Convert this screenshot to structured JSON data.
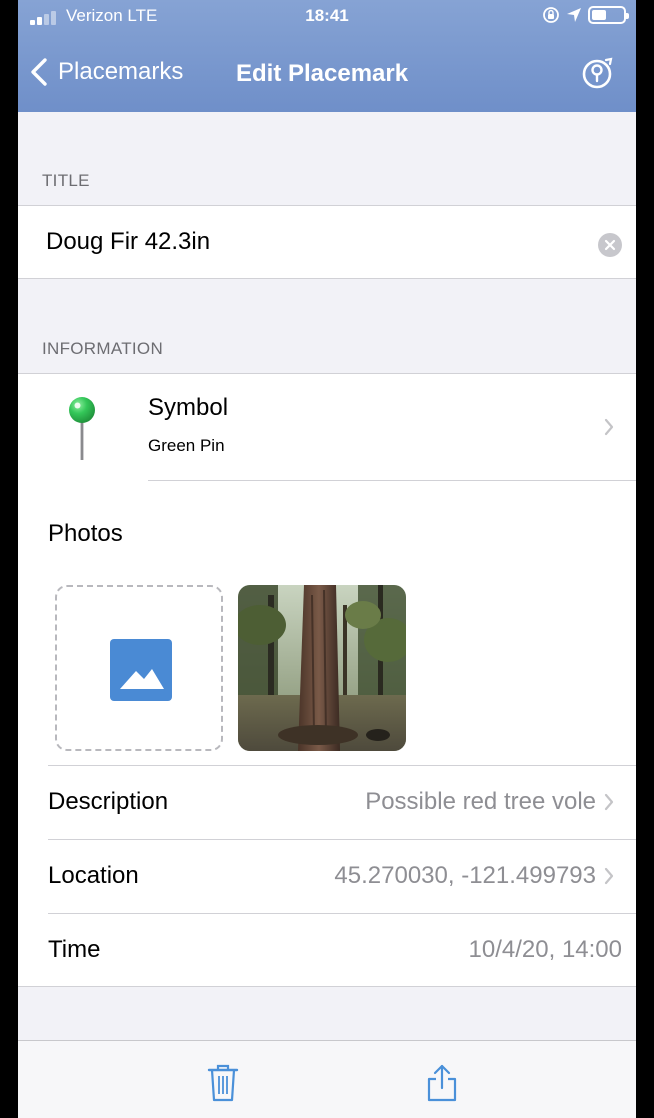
{
  "status_bar": {
    "carrier": "Verizon  LTE",
    "time": "18:41"
  },
  "nav": {
    "back_label": "Placemarks",
    "title": "Edit Placemark",
    "right_icon": "placemark-pin-icon"
  },
  "title_section": {
    "header": "TITLE",
    "value": "Doug Fir 42.3in"
  },
  "information_section": {
    "header": "INFORMATION",
    "symbol": {
      "label": "Symbol",
      "value": "Green Pin",
      "pin_color": "#34c759"
    },
    "photos_label": "Photos",
    "rows": [
      {
        "label": "Description",
        "value": "Possible red tree vole"
      },
      {
        "label": "Location",
        "value": "45.270030, -121.499793"
      },
      {
        "label": "Time",
        "value": "10/4/20, 14:00"
      }
    ]
  },
  "toolbar": {
    "icons": [
      "trash-icon",
      "share-icon"
    ]
  },
  "colors": {
    "accent": "#4a90d9",
    "nav_bg": "#7695cc",
    "secondary_text": "#8e8e93"
  }
}
